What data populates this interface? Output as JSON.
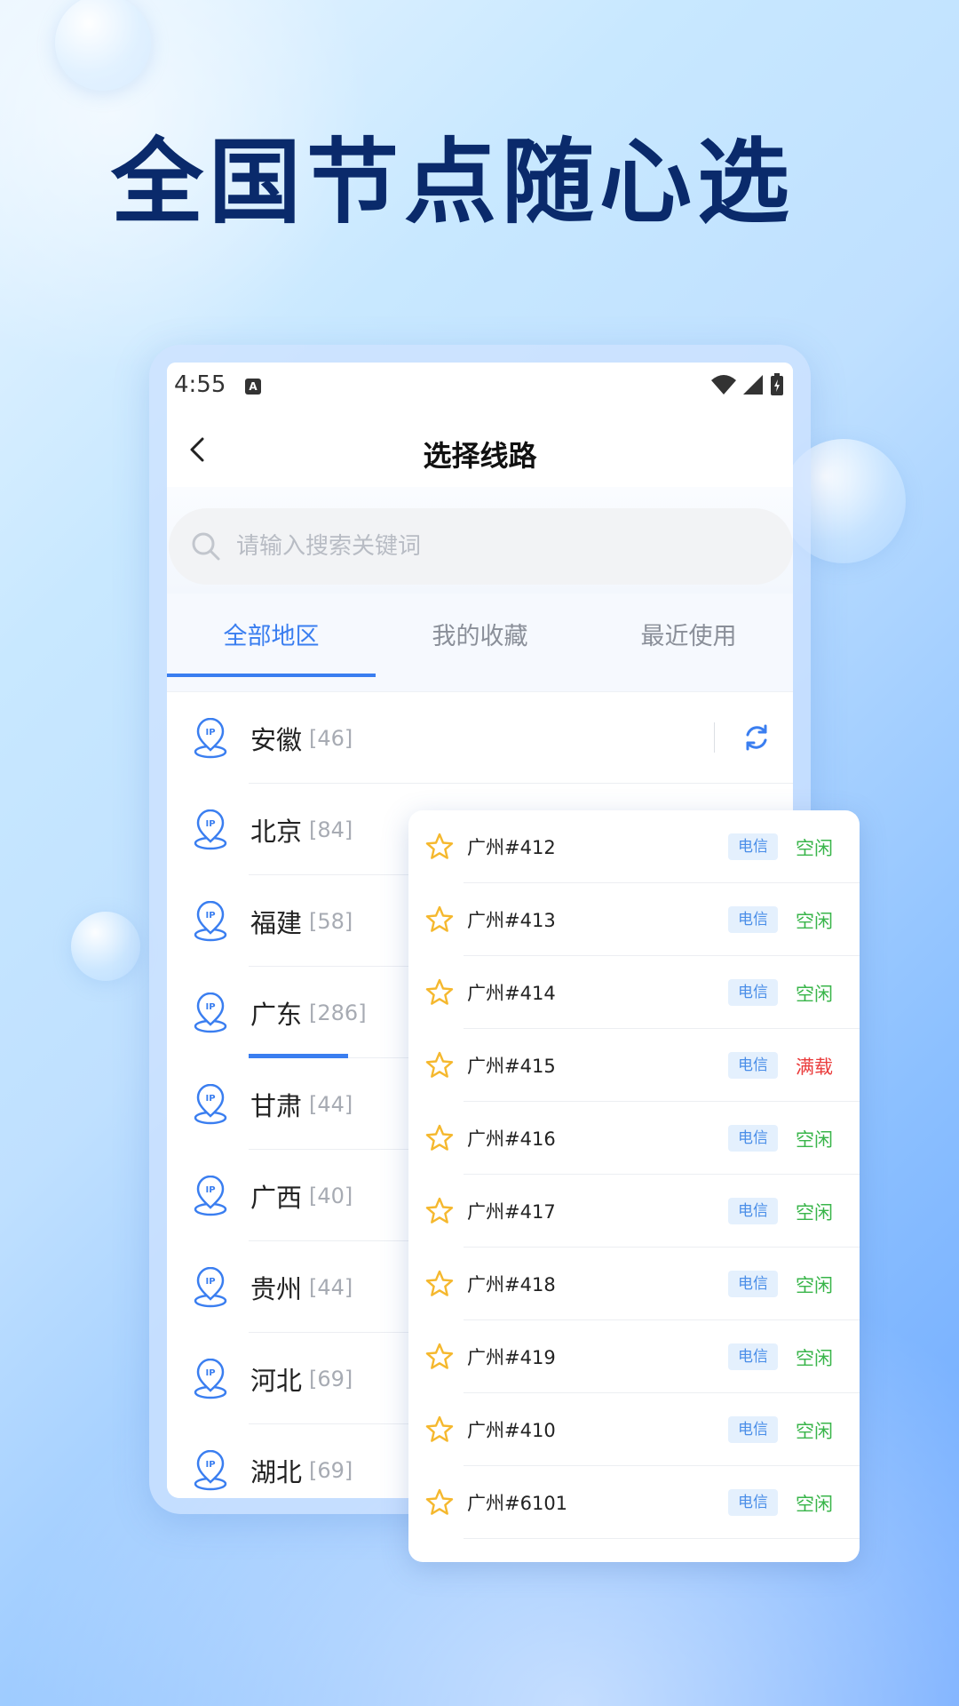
{
  "headline": "全国节点随心选",
  "statusbar": {
    "time": "4:55",
    "notif_letter": "A"
  },
  "navbar": {
    "title": "选择线路"
  },
  "search": {
    "placeholder": "请输入搜索关键词"
  },
  "tabs": [
    {
      "label": "全部地区",
      "active": true
    },
    {
      "label": "我的收藏",
      "active": false
    },
    {
      "label": "最近使用",
      "active": false
    }
  ],
  "regions": [
    {
      "name": "安徽",
      "count": "[46]"
    },
    {
      "name": "北京",
      "count": "[84]"
    },
    {
      "name": "福建",
      "count": "[58]"
    },
    {
      "name": "广东",
      "count": "[286]",
      "selected": true
    },
    {
      "name": "甘肃",
      "count": "[44]"
    },
    {
      "name": "广西",
      "count": "[40]"
    },
    {
      "name": "贵州",
      "count": "[44]"
    },
    {
      "name": "河北",
      "count": "[69]"
    },
    {
      "name": "湖北",
      "count": "[69]"
    }
  ],
  "nodes": [
    {
      "name": "广州#412",
      "isp": "电信",
      "status": "空闲",
      "state": "idle"
    },
    {
      "name": "广州#413",
      "isp": "电信",
      "status": "空闲",
      "state": "idle"
    },
    {
      "name": "广州#414",
      "isp": "电信",
      "status": "空闲",
      "state": "idle"
    },
    {
      "name": "广州#415",
      "isp": "电信",
      "status": "满载",
      "state": "full"
    },
    {
      "name": "广州#416",
      "isp": "电信",
      "status": "空闲",
      "state": "idle"
    },
    {
      "name": "广州#417",
      "isp": "电信",
      "status": "空闲",
      "state": "idle"
    },
    {
      "name": "广州#418",
      "isp": "电信",
      "status": "空闲",
      "state": "idle"
    },
    {
      "name": "广州#419",
      "isp": "电信",
      "status": "空闲",
      "state": "idle"
    },
    {
      "name": "广州#410",
      "isp": "电信",
      "status": "空闲",
      "state": "idle"
    },
    {
      "name": "广州#6101",
      "isp": "电信",
      "status": "空闲",
      "state": "idle"
    }
  ],
  "colors": {
    "accent": "#3a7ef0",
    "headline": "#0a2a6b",
    "idle": "#39b54a",
    "full": "#ea3b3b",
    "star": "#f5b82e"
  }
}
